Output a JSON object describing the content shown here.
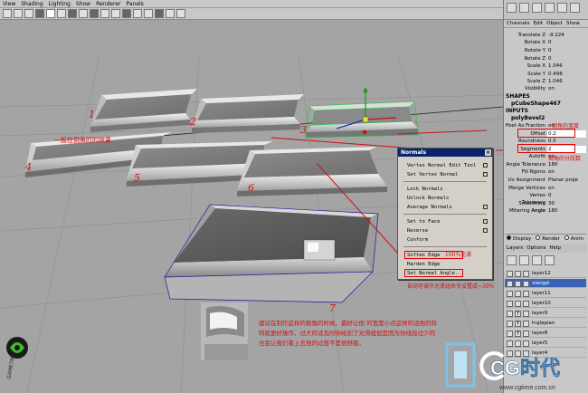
{
  "menubar": [
    "View",
    "Shading",
    "Lighting",
    "Show",
    "Renderer",
    "Panels"
  ],
  "object_labels": [
    "1",
    "2",
    "3",
    "4",
    "5",
    "6",
    "7"
  ],
  "normals_menu": {
    "title": "Normals",
    "close": "×",
    "items": [
      "Vertex Normal Edit Tool",
      "Set Vertex Normal",
      "Lock Normals",
      "Unlock Normals",
      "Average Normals",
      "Set to Face",
      "Reverse",
      "Conform",
      "Soften Edge",
      "Harden Edge",
      "Set Normal Angle..."
    ]
  },
  "annotations": {
    "soften_edge": "100%光滑",
    "auto_soften": "自动可调节光滑组命令设置成~30%",
    "offset_note": "倒角的宽度",
    "segments_note": "倒角的分段数",
    "left_note": "一般在倒角时的效果",
    "bottom_note": "建议在制作这样的倒角的时候，最好让他 的宽度小点这样的话他的科特就更好操作，过大的话及时你给到了光滑组但是因为你线段过少的也会让我们看上去他的过度不是很舒服。"
  },
  "channel_box": {
    "menu": [
      "Channels",
      "Edit",
      "Object",
      "Show"
    ],
    "attributes": [
      {
        "label": "Translate Z",
        "value": "-9.224"
      },
      {
        "label": "Rotate X",
        "value": "0"
      },
      {
        "label": "Rotate Y",
        "value": "0"
      },
      {
        "label": "Rotate Z",
        "value": "0"
      },
      {
        "label": "Scale X",
        "value": "1.046"
      },
      {
        "label": "Scale Y",
        "value": "0.498"
      },
      {
        "label": "Scale Z",
        "value": "1.046"
      },
      {
        "label": "Visibility",
        "value": "on"
      }
    ],
    "shapes_head": "SHAPES",
    "shape_name": "pCubeShape467",
    "inputs_head": "INPUTS",
    "input_name": "polyBevel2",
    "input_attrs": [
      {
        "label": "ffset As Fraction",
        "value": "on"
      },
      {
        "label": "Offset",
        "value": "0.2"
      },
      {
        "label": "Roundness",
        "value": "0.5"
      },
      {
        "label": "Segments",
        "value": "2"
      },
      {
        "label": "Autofit",
        "value": "on"
      },
      {
        "label": "Angle Tolerance",
        "value": "180"
      },
      {
        "label": "Fill Ngons",
        "value": "on"
      },
      {
        "label": "Uv Assignment",
        "value": "Planar proje"
      },
      {
        "label": "Merge Vertices",
        "value": "on"
      },
      {
        "label": "Vertex Tolerance",
        "value": "0"
      },
      {
        "label": "Smoothing Angle",
        "value": "30"
      },
      {
        "label": "Mitering Angle",
        "value": "180"
      }
    ]
  },
  "display_tabs": [
    "Display",
    "Render",
    "Anim"
  ],
  "layers_menu": [
    "Layers",
    "Options",
    "Help"
  ],
  "layers": [
    {
      "name": "layer12",
      "v": "",
      "t": ""
    },
    {
      "name": "xiangzi",
      "v": "",
      "t": ""
    },
    {
      "name": "layer11",
      "v": "",
      "t": ""
    },
    {
      "name": "layer10",
      "v": "",
      "t": ""
    },
    {
      "name": "layer9",
      "v": "",
      "t": "T"
    },
    {
      "name": "hujiapian",
      "v": "",
      "t": "T"
    },
    {
      "name": "layer8",
      "v": "",
      "t": "T"
    },
    {
      "name": "layer5",
      "v": "",
      "t": ""
    },
    {
      "name": "layer4",
      "v": "",
      "t": ""
    }
  ],
  "branding": {
    "game_logo": "GAME798",
    "cg_logo": "CG时代",
    "cg_url": "www.cgtime.com.cn"
  }
}
